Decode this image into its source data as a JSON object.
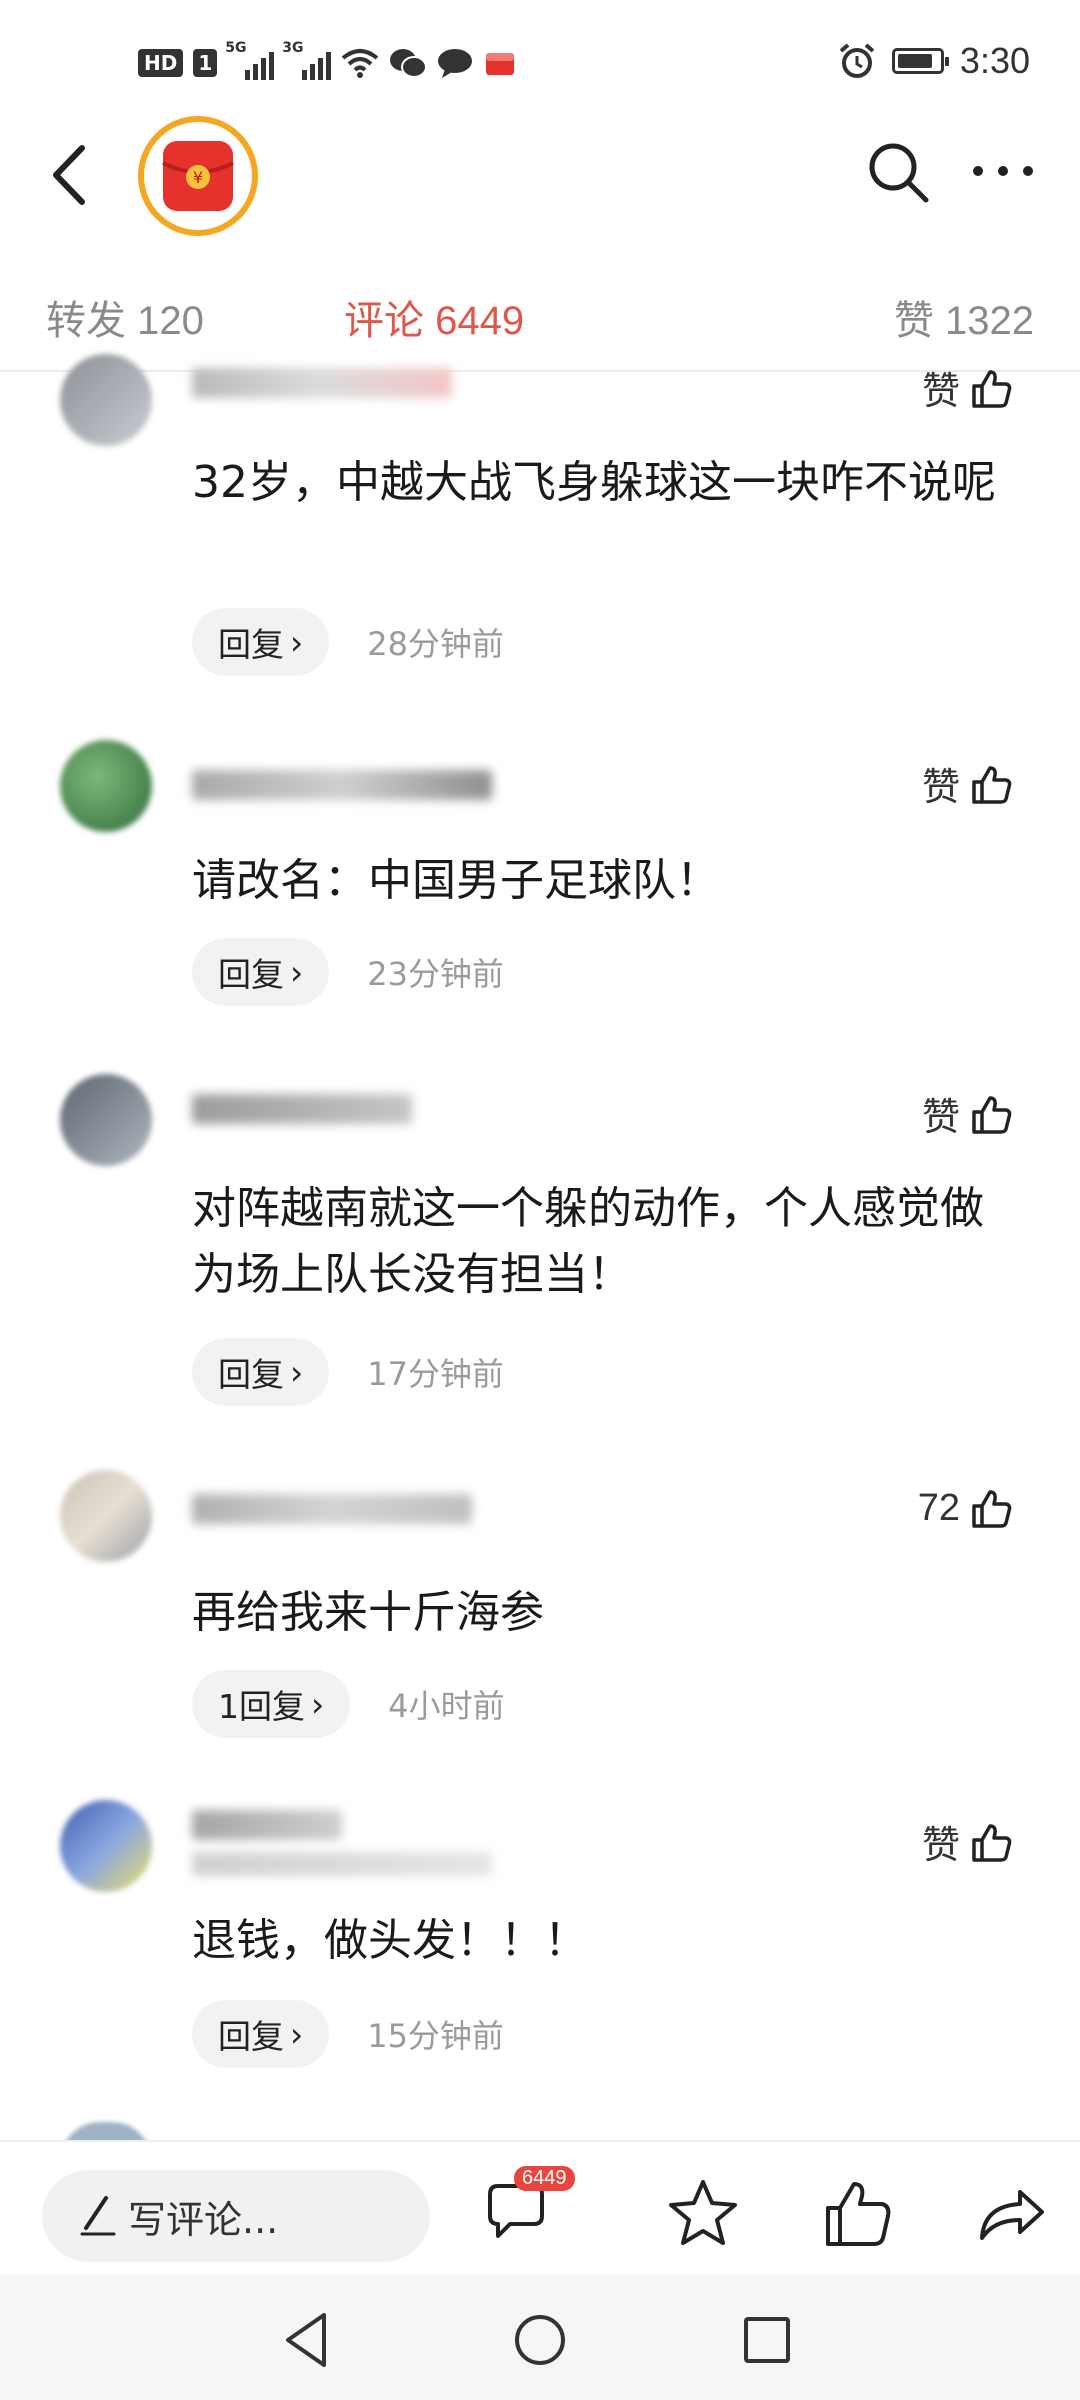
{
  "status_bar": {
    "hd_label": "HD",
    "sim_labels": [
      "5G",
      "3G"
    ],
    "time": "3:30",
    "battery_level": 0.85,
    "icons": [
      "hd-icon",
      "signal-5g-icon",
      "signal-3g-icon",
      "wifi-icon",
      "wechat-icon",
      "chat-bubble-icon",
      "app-notification-icon",
      "alarm-icon",
      "battery-icon"
    ]
  },
  "nav": {
    "icons": [
      "back-icon",
      "red-envelope-avatar-icon",
      "search-icon",
      "more-icon"
    ],
    "avatar_symbol": "¥"
  },
  "tabs": [
    {
      "label": "转发 120"
    },
    {
      "label": "评论 6449",
      "active": true
    },
    {
      "label": "赞 1322"
    }
  ],
  "comments": [
    {
      "text": "32岁，中越大战飞身躲球这一块咋不说呢",
      "like_label": "赞",
      "reply_label": "回复",
      "time": "28分钟前"
    },
    {
      "text": "请改名：中国男子足球队！",
      "like_label": "赞",
      "reply_label": "回复",
      "time": "23分钟前"
    },
    {
      "text": "对阵越南就这一个躲的动作，个人感觉做为场上队长没有担当！",
      "like_label": "赞",
      "reply_label": "回复",
      "time": "17分钟前"
    },
    {
      "text": "再给我来十斤海参",
      "like_label": "72",
      "reply_label": "1回复",
      "time": "4小时前"
    },
    {
      "text": "退钱，做头发！！！",
      "like_label": "赞",
      "reply_label": "回复",
      "time": "15分钟前"
    }
  ],
  "bottom_bar": {
    "write_placeholder": "写评论...",
    "comment_count_badge": "6449",
    "icons": [
      "pencil-icon",
      "comment-icon",
      "star-icon",
      "thumbs-up-icon",
      "share-icon"
    ]
  },
  "system_nav": {
    "icons": [
      "nav-back-icon",
      "nav-home-icon",
      "nav-recents-icon"
    ]
  },
  "colors": {
    "accent": "#e0574a",
    "avatar_ring": "#f5a623",
    "red_envelope": "#e5322d",
    "badge": "#e9453f"
  }
}
